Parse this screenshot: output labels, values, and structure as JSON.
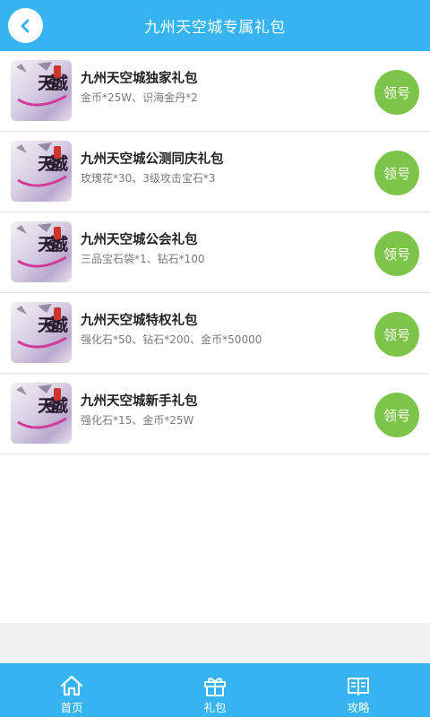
{
  "header": {
    "title": "九州天空城专属礼包",
    "back_icon": "back-chevron-icon"
  },
  "gifts": [
    {
      "title": "九州天空城独家礼包",
      "desc": "金币*25W、识海金丹*2",
      "button": "领号"
    },
    {
      "title": "九州天空城公测同庆礼包",
      "desc": "玫瑰花*30、3级攻击宝石*3",
      "button": "领号"
    },
    {
      "title": "九州天空城公会礼包",
      "desc": "三品宝石袋*1、钻石*100",
      "button": "领号"
    },
    {
      "title": "九州天空城特权礼包",
      "desc": "强化石*50、钻石*200、金币*50000",
      "button": "领号"
    },
    {
      "title": "九州天空城新手礼包",
      "desc": "强化石*15、金币*25W",
      "button": "领号"
    }
  ],
  "thumb_logo": "天空城",
  "nav": [
    {
      "label": "首页",
      "icon": "home-icon"
    },
    {
      "label": "礼包",
      "icon": "gift-icon"
    },
    {
      "label": "攻略",
      "icon": "book-icon"
    }
  ],
  "colors": {
    "header_bg": "#36b4f1",
    "button_green": "#7dc54a",
    "page_bg": "#f1f1f1"
  }
}
